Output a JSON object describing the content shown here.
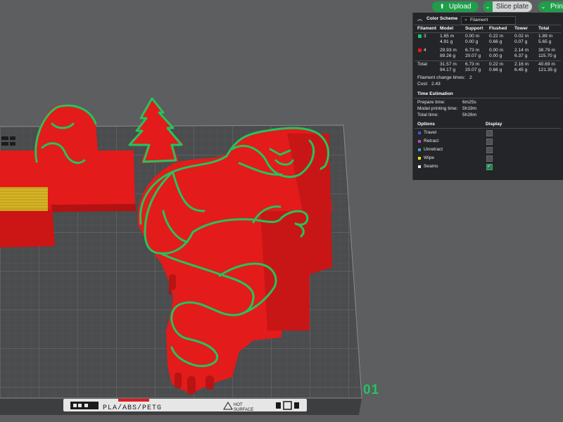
{
  "toolbar": {
    "upload_label": "Upload",
    "slice_label": "Slice plate",
    "print_label": "Prin"
  },
  "stats": {
    "color_scheme_label": "Color Scheme",
    "color_scheme_value": "Filament",
    "headers": [
      "Filament",
      "Model",
      "Support",
      "Flushed",
      "Tower",
      "Total"
    ],
    "filaments": [
      {
        "id": "3",
        "color": "#22c55e",
        "model": [
          "1.65 m",
          "4.91 g"
        ],
        "support": [
          "0.00 m",
          "0.00 g"
        ],
        "flushed": [
          "0.22 m",
          "0.66 g"
        ],
        "tower": [
          "0.02 m",
          "0.07 g"
        ],
        "total": [
          "1.89 m",
          "5.65 g"
        ]
      },
      {
        "id": "4",
        "color": "#e31b1b",
        "model": [
          "29.93 m",
          "89.26 g"
        ],
        "support": [
          "6.73 m",
          "20.07 g"
        ],
        "flushed": [
          "0.00 m",
          "0.00 g"
        ],
        "tower": [
          "2.14 m",
          "6.37 g"
        ],
        "total": [
          "38.79 m",
          "115.70 g"
        ]
      }
    ],
    "total_row": {
      "label": "Total",
      "model": [
        "31.57 m",
        "94.17 g"
      ],
      "support": [
        "6.73 m",
        "20.07 g"
      ],
      "flushed": [
        "0.22 m",
        "0.66 g"
      ],
      "tower": [
        "2.16 m",
        "6.45 g"
      ],
      "total": [
        "40.69 m",
        "121.35 g"
      ]
    },
    "filament_change_label": "Filament change times:",
    "filament_change_value": "2",
    "cost_label": "Cost:",
    "cost_value": "2.43",
    "time_estimation_label": "Time Estimation",
    "prepare_time_label": "Prepare time:",
    "prepare_time_value": "6m25s",
    "model_time_label": "Model printing time:",
    "model_time_value": "5h19m",
    "total_time_label": "Total time:",
    "total_time_value": "5h26m",
    "options_label": "Options",
    "display_label": "Display",
    "options": [
      {
        "label": "Travel",
        "color": "#3b5bd6",
        "checked": false
      },
      {
        "label": "Retract",
        "color": "#c640c6",
        "checked": false
      },
      {
        "label": "Unretract",
        "color": "#2fa6b8",
        "checked": false
      },
      {
        "label": "Wipe",
        "color": "#e6e61a",
        "checked": false
      },
      {
        "label": "Seams",
        "color": "#e8e8e8",
        "checked": true
      }
    ]
  },
  "plate": {
    "number": "01",
    "filament_type": "PLA/ABS/PETG",
    "surface_line1": "HOT",
    "surface_line2": "SURFACE"
  },
  "colors": {
    "model_red": "#e31b1b",
    "filament_green": "#22c55e",
    "background": "#5c5e60",
    "bed": "#4a4c4e",
    "panel": "#242528"
  }
}
